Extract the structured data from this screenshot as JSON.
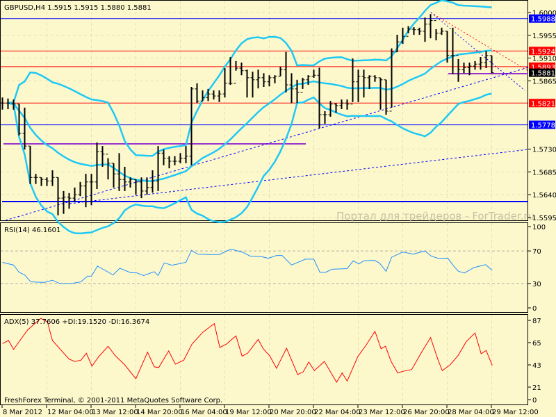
{
  "header": {
    "symbol_label": "GBPUSD,H4  1.5915 1.5915 1.5880 1.5881"
  },
  "watermark": "Портал для трейдеров - ForTrader.ru",
  "copyright": "FreshForex Terminal, © 2001-2011 MetaQuotes Software Corp.",
  "colors": {
    "background": "#fcf8cc",
    "bars": "#000000",
    "bands": "#1ec8f5",
    "rsi": "#1e90ff",
    "adx": "#ff0000",
    "resistance": "#ff0000",
    "support": "#0000ff",
    "purple": "#9932cc"
  },
  "chart_data": [
    {
      "type": "ohlc",
      "title": "GBPUSD,H4",
      "ylim": [
        1.5595,
        1.6015
      ],
      "y_ticks": [
        "1.6000",
        "1.5955",
        "1.5910",
        "1.5865",
        "1.5730",
        "1.5685",
        "1.5640",
        "1.5595"
      ],
      "x_ticks": [
        "8 Mar 2012",
        "12 Mar 04:00",
        "13 Mar 12:00",
        "14 Mar 20:00",
        "16 Mar 04:00",
        "19 Mar 12:00",
        "20 Mar 20:00",
        "22 Mar 04:00",
        "23 Mar 12:00",
        "26 Mar 20:00",
        "28 Mar 04:00",
        "29 Mar 12:00"
      ],
      "bars_hlc": [
        [
          1.5832,
          1.5808,
          1.5821
        ],
        [
          1.583,
          1.5809,
          1.5821
        ],
        [
          1.5828,
          1.5808,
          1.5819
        ],
        [
          1.5819,
          1.5757,
          1.5761
        ],
        [
          1.5812,
          1.5729,
          1.5736
        ],
        [
          1.5736,
          1.5661,
          1.5674
        ],
        [
          1.5681,
          1.5661,
          1.5674
        ],
        [
          1.5674,
          1.5657,
          1.567
        ],
        [
          1.5674,
          1.5657,
          1.5667
        ],
        [
          1.5688,
          1.5657,
          1.5674
        ],
        [
          1.5674,
          1.5599,
          1.5633
        ],
        [
          1.5647,
          1.5602,
          1.5635
        ],
        [
          1.5643,
          1.5612,
          1.5633
        ],
        [
          1.5654,
          1.5626,
          1.564
        ],
        [
          1.5665,
          1.5637,
          1.5657
        ],
        [
          1.5681,
          1.5615,
          1.5665
        ],
        [
          1.5681,
          1.5619,
          1.5665
        ],
        [
          1.5743,
          1.5651,
          1.5725
        ],
        [
          1.5736,
          1.5695,
          1.572
        ],
        [
          1.5712,
          1.567,
          1.5702
        ],
        [
          1.5702,
          1.5654,
          1.5681
        ],
        [
          1.5722,
          1.5647,
          1.567
        ],
        [
          1.5695,
          1.5647,
          1.5665
        ],
        [
          1.5674,
          1.5654,
          1.567
        ],
        [
          1.567,
          1.564,
          1.5665
        ],
        [
          1.5674,
          1.5633,
          1.5647
        ],
        [
          1.5674,
          1.564,
          1.5654
        ],
        [
          1.5688,
          1.5644,
          1.5667
        ],
        [
          1.5736,
          1.5647,
          1.5722
        ],
        [
          1.5729,
          1.5698,
          1.5712
        ],
        [
          1.5716,
          1.5692,
          1.5706
        ],
        [
          1.5716,
          1.5698,
          1.5706
        ],
        [
          1.5722,
          1.5702,
          1.5712
        ],
        [
          1.5736,
          1.5702,
          1.5716
        ],
        [
          1.5853,
          1.5698,
          1.5849
        ],
        [
          1.586,
          1.5821,
          1.5825
        ],
        [
          1.5846,
          1.5825,
          1.5832
        ],
        [
          1.5849,
          1.5825,
          1.5839
        ],
        [
          1.5846,
          1.5828,
          1.5835
        ],
        [
          1.5846,
          1.5823,
          1.5839
        ],
        [
          1.589,
          1.5832,
          1.586
        ],
        [
          1.5912,
          1.5857,
          1.586
        ],
        [
          1.5904,
          1.5885,
          1.589
        ],
        [
          1.5901,
          1.5876,
          1.5885
        ],
        [
          1.5887,
          1.5832,
          1.5871
        ],
        [
          1.5883,
          1.5832,
          1.5867
        ],
        [
          1.5887,
          1.585,
          1.5871
        ],
        [
          1.588,
          1.5853,
          1.5863
        ],
        [
          1.5876,
          1.5854,
          1.5871
        ],
        [
          1.5876,
          1.586,
          1.5874
        ],
        [
          1.5893,
          1.5874,
          1.5887
        ],
        [
          1.5922,
          1.5842,
          1.5857
        ],
        [
          1.588,
          1.5821,
          1.5849
        ],
        [
          1.5867,
          1.5821,
          1.5842
        ],
        [
          1.5871,
          1.5849,
          1.5867
        ],
        [
          1.5876,
          1.5857,
          1.5874
        ],
        [
          1.5887,
          1.5871,
          1.5876
        ],
        [
          1.5891,
          1.5771,
          1.5798
        ],
        [
          1.5805,
          1.578,
          1.5798
        ],
        [
          1.5825,
          1.5794,
          1.5819
        ],
        [
          1.5821,
          1.5802,
          1.5816
        ],
        [
          1.5828,
          1.5809,
          1.5821
        ],
        [
          1.5828,
          1.5808,
          1.5819
        ],
        [
          1.5909,
          1.5823,
          1.5863
        ],
        [
          1.5887,
          1.5823,
          1.5874
        ],
        [
          1.5887,
          1.5832,
          1.5871
        ],
        [
          1.5876,
          1.5849,
          1.5874
        ],
        [
          1.5876,
          1.5863,
          1.5871
        ],
        [
          1.5871,
          1.5808,
          1.5867
        ],
        [
          1.5867,
          1.5798,
          1.5805
        ],
        [
          1.5929,
          1.5812,
          1.5922
        ],
        [
          1.5956,
          1.5922,
          1.5942
        ],
        [
          1.597,
          1.5938,
          1.5953
        ],
        [
          1.5973,
          1.5959,
          1.5967
        ],
        [
          1.5971,
          1.5956,
          1.5966
        ],
        [
          1.597,
          1.5956,
          1.5963
        ],
        [
          1.599,
          1.5942,
          1.5977
        ],
        [
          1.5997,
          1.5949,
          1.5984
        ],
        [
          1.5967,
          1.5945,
          1.5959
        ],
        [
          1.597,
          1.5956,
          1.5963
        ],
        [
          1.5963,
          1.5901,
          1.5915
        ],
        [
          1.597,
          1.5878,
          1.5915
        ],
        [
          1.5908,
          1.5863,
          1.5887
        ],
        [
          1.5901,
          1.588,
          1.5891
        ],
        [
          1.5901,
          1.5876,
          1.5894
        ],
        [
          1.5904,
          1.5887,
          1.5898
        ],
        [
          1.5912,
          1.5887,
          1.5901
        ],
        [
          1.5924,
          1.589,
          1.5915
        ],
        [
          1.5915,
          1.588,
          1.5881
        ]
      ],
      "levels": [
        {
          "price": 1.5988,
          "label": "1.5988",
          "color": "#0000ff",
          "tag_bg": "#0000ff"
        },
        {
          "price": 1.5924,
          "label": "1.5924",
          "color": "#ff0000",
          "tag_bg": "#ff0000"
        },
        {
          "price": 1.5893,
          "label": "1.5893",
          "color": "#ff0000",
          "tag_bg": "#ff0000"
        },
        {
          "price": 1.5881,
          "label": "1.5881",
          "color": "#000000",
          "tag_bg": "#000000"
        },
        {
          "price": 1.5821,
          "label": "1.5821",
          "color": "#ff0000",
          "tag_bg": "#ff0000"
        },
        {
          "price": 1.5778,
          "label": "1.5778",
          "color": "#0000ff",
          "tag_bg": "#0000ff"
        }
      ],
      "indicator": "Bollinger Bands (20, 2)"
    },
    {
      "type": "line",
      "title": "RSI(14) 46.1601",
      "ylim": [
        0,
        100
      ],
      "y_ticks": [
        "100",
        "70",
        "30",
        "0"
      ],
      "levels": [
        70,
        30
      ],
      "points": [
        [
          0,
          56
        ],
        [
          2,
          52.7
        ],
        [
          3,
          43.7
        ],
        [
          4,
          40.6
        ],
        [
          5.1,
          32
        ],
        [
          7.5,
          31.3
        ],
        [
          9,
          34
        ],
        [
          10.3,
          30
        ],
        [
          12.4,
          30
        ],
        [
          14.1,
          32
        ],
        [
          15.3,
          39
        ],
        [
          16,
          39
        ],
        [
          17.1,
          51.4
        ],
        [
          19.9,
          40.6
        ],
        [
          21.1,
          48.8
        ],
        [
          23.1,
          43.2
        ],
        [
          24.1,
          43.2
        ],
        [
          25.4,
          39.8
        ],
        [
          27.3,
          44.5
        ],
        [
          28,
          39.8
        ],
        [
          29.1,
          55.3
        ],
        [
          30.5,
          52.5
        ],
        [
          33,
          56
        ],
        [
          34,
          70.8
        ],
        [
          35.1,
          66.1
        ],
        [
          37.1,
          65.6
        ],
        [
          39,
          65.6
        ],
        [
          41.1,
          72.3
        ],
        [
          43.3,
          68.2
        ],
        [
          44.5,
          63.8
        ],
        [
          46.6,
          63
        ],
        [
          47.8,
          61
        ],
        [
          49.3,
          64.4
        ],
        [
          50.3,
          64.4
        ],
        [
          52,
          52.7
        ],
        [
          54.5,
          59.9
        ],
        [
          56,
          59.9
        ],
        [
          57.1,
          43.7
        ],
        [
          58.1,
          43.7
        ],
        [
          59.3,
          47.5
        ],
        [
          62,
          48.3
        ],
        [
          63.1,
          57.9
        ],
        [
          64.1,
          54
        ],
        [
          65,
          57.9
        ],
        [
          66.9,
          58.4
        ],
        [
          67.8,
          55.3
        ],
        [
          69,
          45
        ],
        [
          70,
          62.3
        ],
        [
          72,
          68.7
        ],
        [
          73.9,
          66.1
        ],
        [
          76,
          70
        ],
        [
          77.1,
          63.8
        ],
        [
          78.3,
          61
        ],
        [
          80.1,
          61.2
        ],
        [
          81.1,
          52
        ],
        [
          82,
          45
        ],
        [
          83.1,
          42.9
        ],
        [
          84.8,
          49.6
        ],
        [
          86.9,
          53.2
        ],
        [
          88.1,
          46.16
        ]
      ]
    },
    {
      "type": "line",
      "title": "ADX(5) 37.7606 +DI:19.1520 -DI:16.3674",
      "ylim": [
        0,
        87
      ],
      "y_ticks": [
        "87",
        "65",
        "43",
        "21",
        "0"
      ],
      "points": [
        [
          0,
          64.1
        ],
        [
          1.1,
          67.1
        ],
        [
          2,
          58.3
        ],
        [
          4.5,
          77.4
        ],
        [
          6.9,
          89
        ],
        [
          8.1,
          85.4
        ],
        [
          9,
          67.1
        ],
        [
          10.3,
          59
        ],
        [
          12,
          48.7
        ],
        [
          13,
          46.4
        ],
        [
          14.1,
          47.6
        ],
        [
          15.1,
          54.5
        ],
        [
          16.1,
          41.8
        ],
        [
          17.3,
          51
        ],
        [
          19,
          61.4
        ],
        [
          20.3,
          52.1
        ],
        [
          22,
          43
        ],
        [
          24,
          29.3
        ],
        [
          26.1,
          55.6
        ],
        [
          27.3,
          41.1
        ],
        [
          28.1,
          40.3
        ],
        [
          29.9,
          56.8
        ],
        [
          31.1,
          43.7
        ],
        [
          32.6,
          47.6
        ],
        [
          34.1,
          63.6
        ],
        [
          36,
          75.1
        ],
        [
          38.1,
          83.8
        ],
        [
          39.1,
          60.2
        ],
        [
          40.3,
          63.6
        ],
        [
          42,
          71.7
        ],
        [
          43.1,
          51.7
        ],
        [
          44.1,
          54.5
        ],
        [
          46,
          68.2
        ],
        [
          46.9,
          59
        ],
        [
          48.1,
          51.7
        ],
        [
          49.3,
          39.6
        ],
        [
          51.1,
          59.5
        ],
        [
          53.1,
          33.4
        ],
        [
          54.1,
          36.1
        ],
        [
          55.1,
          45.8
        ],
        [
          56.1,
          37.3
        ],
        [
          57.9,
          46.4
        ],
        [
          60.1,
          25.8
        ],
        [
          61.1,
          35
        ],
        [
          62,
          27
        ],
        [
          63.9,
          51
        ],
        [
          65.4,
          62.5
        ],
        [
          67,
          76.2
        ],
        [
          68.1,
          59
        ],
        [
          68.9,
          61.4
        ],
        [
          69.9,
          46.4
        ],
        [
          71.1,
          35
        ],
        [
          72,
          36.6
        ],
        [
          73.6,
          38.4
        ],
        [
          75.4,
          55.6
        ],
        [
          77,
          70
        ],
        [
          78.3,
          48.7
        ],
        [
          79.1,
          37.3
        ],
        [
          80.5,
          43
        ],
        [
          82,
          52.6
        ],
        [
          83.4,
          65.9
        ],
        [
          85,
          74.6
        ],
        [
          86.1,
          54
        ],
        [
          87,
          57.2
        ],
        [
          88.1,
          42.5
        ]
      ]
    }
  ]
}
